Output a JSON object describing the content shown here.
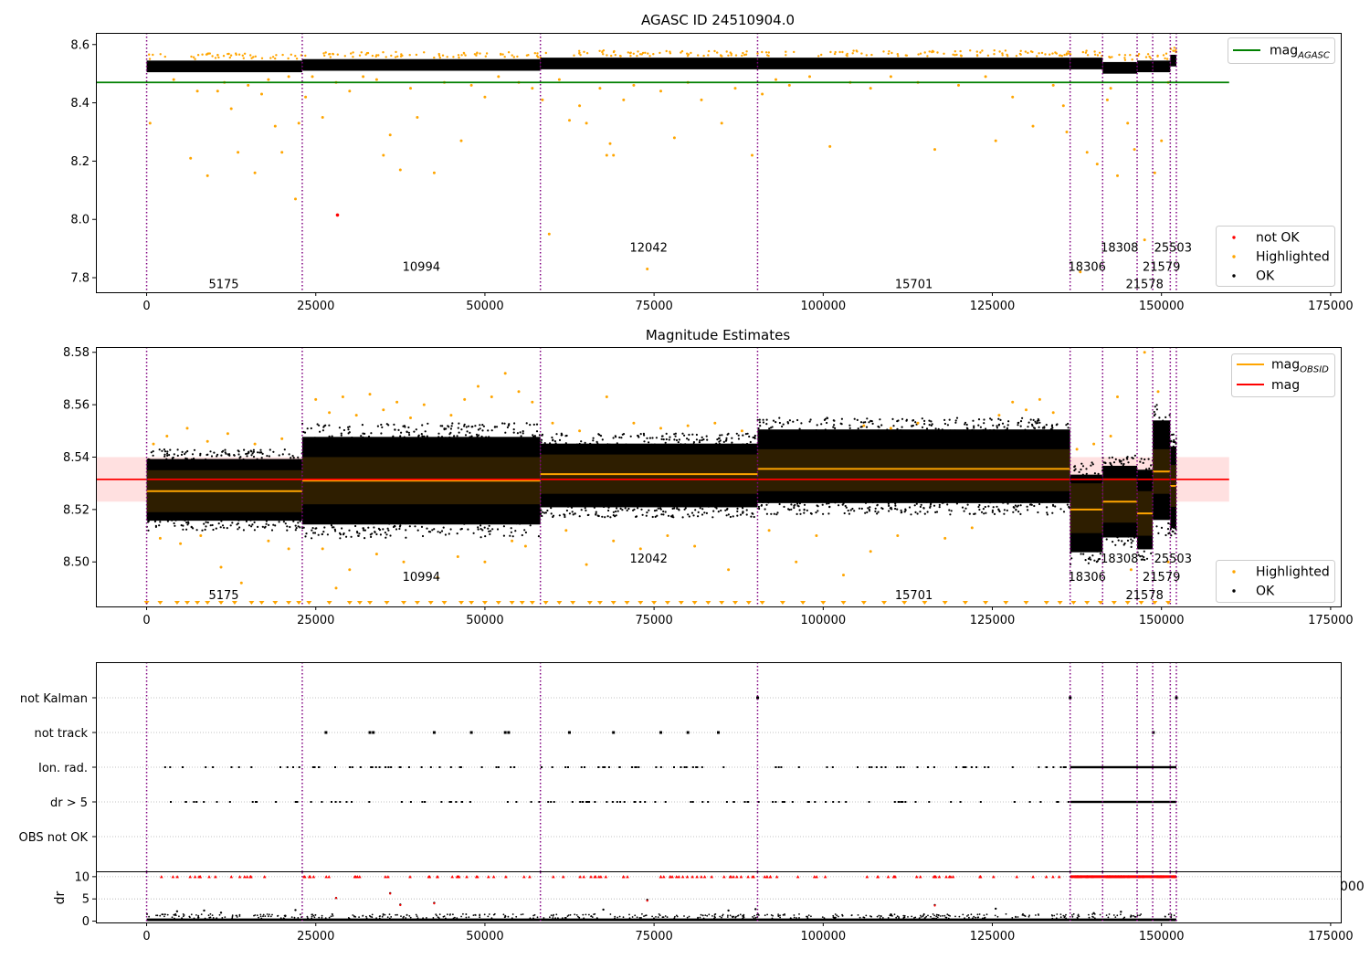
{
  "colors": {
    "ok": "#000000",
    "highlighted": "#ffa500",
    "not_ok": "#ff0000",
    "mag_agasc": "#008000",
    "mag": "#ff0000",
    "mag_obsid": "#ffa500",
    "obs_boundary": "#800080",
    "band_fill": "#ffcccc"
  },
  "chart_data": [
    {
      "type": "scatter",
      "title": "AGASC ID 24510904.0",
      "xlim": [
        -7500,
        176500
      ],
      "ylim": [
        7.75,
        8.64
      ],
      "xticks": [
        0,
        25000,
        50000,
        75000,
        100000,
        125000,
        150000,
        175000
      ],
      "xtick_labels": [
        "0",
        "25000",
        "50000",
        "75000",
        "100000",
        "125000",
        "150000",
        "175000"
      ],
      "yticks": [
        7.8,
        8.0,
        8.2,
        8.4,
        8.6
      ],
      "ytick_labels": [
        "7.8",
        "8.0",
        "8.2",
        "8.4",
        "8.6"
      ],
      "obs_boundaries": [
        0,
        23000,
        58200,
        90300,
        136500,
        141300,
        146400,
        148700,
        151300,
        152200
      ],
      "obsid_labels": [
        {
          "text": "5175",
          "x": 11400,
          "y": 7.78
        },
        {
          "text": "10994",
          "x": 40600,
          "y": 7.84
        },
        {
          "text": "12042",
          "x": 74200,
          "y": 7.905
        },
        {
          "text": "15701",
          "x": 113400,
          "y": 7.78
        },
        {
          "text": "18306",
          "x": 139000,
          "y": 7.84
        },
        {
          "text": "18308",
          "x": 143800,
          "y": 7.905
        },
        {
          "text": "21578",
          "x": 147500,
          "y": 7.78
        },
        {
          "text": "21579",
          "x": 150000,
          "y": 7.84
        },
        {
          "text": "25503",
          "x": 151700,
          "y": 7.905
        }
      ],
      "mag_agasc": 8.47,
      "mag_agasc_xrange": [
        -7500,
        160000
      ],
      "segments_mean": [
        8.525,
        8.53,
        8.535,
        8.535,
        8.535,
        8.52,
        8.525,
        8.525,
        8.545,
        8.53
      ],
      "highlighted_points": [
        [
          500,
          8.33
        ],
        [
          4000,
          8.48
        ],
        [
          6500,
          8.21
        ],
        [
          7500,
          8.44
        ],
        [
          9000,
          8.15
        ],
        [
          10500,
          8.44
        ],
        [
          11500,
          8.47
        ],
        [
          12500,
          8.38
        ],
        [
          13500,
          8.23
        ],
        [
          15000,
          8.46
        ],
        [
          16000,
          8.16
        ],
        [
          17000,
          8.43
        ],
        [
          18000,
          8.48
        ],
        [
          19000,
          8.32
        ],
        [
          20000,
          8.23
        ],
        [
          21000,
          8.49
        ],
        [
          22000,
          8.07
        ],
        [
          22500,
          8.33
        ],
        [
          23500,
          8.42
        ],
        [
          24500,
          8.49
        ],
        [
          26000,
          8.35
        ],
        [
          28000,
          8.47
        ],
        [
          30000,
          8.44
        ],
        [
          32000,
          8.49
        ],
        [
          34000,
          8.48
        ],
        [
          35000,
          8.22
        ],
        [
          36000,
          8.29
        ],
        [
          37500,
          8.17
        ],
        [
          39000,
          8.45
        ],
        [
          40000,
          8.35
        ],
        [
          42500,
          8.16
        ],
        [
          44000,
          8.47
        ],
        [
          46500,
          8.27
        ],
        [
          48000,
          8.46
        ],
        [
          50000,
          8.42
        ],
        [
          52000,
          8.49
        ],
        [
          55000,
          8.47
        ],
        [
          57000,
          8.45
        ],
        [
          58500,
          8.41
        ],
        [
          59500,
          7.95
        ],
        [
          61000,
          8.48
        ],
        [
          62500,
          8.34
        ],
        [
          64000,
          8.39
        ],
        [
          65000,
          8.33
        ],
        [
          67000,
          8.45
        ],
        [
          68000,
          8.22
        ],
        [
          68500,
          8.26
        ],
        [
          69000,
          8.22
        ],
        [
          70500,
          8.41
        ],
        [
          72000,
          8.46
        ],
        [
          74000,
          7.83
        ],
        [
          76000,
          8.44
        ],
        [
          78000,
          8.28
        ],
        [
          80000,
          8.47
        ],
        [
          82000,
          8.41
        ],
        [
          85000,
          8.33
        ],
        [
          87000,
          8.45
        ],
        [
          89500,
          8.22
        ],
        [
          91000,
          8.43
        ],
        [
          93000,
          8.48
        ],
        [
          95000,
          8.46
        ],
        [
          98000,
          8.49
        ],
        [
          101000,
          8.25
        ],
        [
          104000,
          8.47
        ],
        [
          107000,
          8.45
        ],
        [
          110000,
          8.49
        ],
        [
          114000,
          8.47
        ],
        [
          116500,
          8.24
        ],
        [
          120000,
          8.46
        ],
        [
          124000,
          8.49
        ],
        [
          125500,
          8.27
        ],
        [
          128000,
          8.42
        ],
        [
          131000,
          8.32
        ],
        [
          134000,
          8.46
        ],
        [
          135500,
          8.39
        ],
        [
          136000,
          8.3
        ],
        [
          138000,
          7.82
        ],
        [
          139000,
          8.23
        ],
        [
          140500,
          8.19
        ],
        [
          142000,
          8.41
        ],
        [
          142500,
          8.45
        ],
        [
          143500,
          8.15
        ],
        [
          145000,
          8.33
        ],
        [
          146000,
          8.24
        ],
        [
          147500,
          7.93
        ],
        [
          149000,
          8.16
        ],
        [
          150000,
          8.27
        ],
        [
          151000,
          8.47
        ]
      ],
      "not_ok_points": [
        [
          28200,
          8.015
        ]
      ],
      "legend_top": [
        {
          "label": "mag_AGASC"
        }
      ],
      "legend_bottom": [
        {
          "label": "not OK"
        },
        {
          "label": "Highlighted"
        },
        {
          "label": "OK"
        }
      ]
    },
    {
      "type": "scatter",
      "title": "Magnitude Estimates",
      "xlim": [
        -7500,
        176500
      ],
      "ylim": [
        8.483,
        8.582
      ],
      "xticks": [
        0,
        25000,
        50000,
        75000,
        100000,
        125000,
        150000,
        175000
      ],
      "xtick_labels": [
        "0",
        "25000",
        "50000",
        "75000",
        "100000",
        "125000",
        "150000",
        "175000"
      ],
      "yticks": [
        8.5,
        8.52,
        8.54,
        8.56,
        8.58
      ],
      "ytick_labels": [
        "8.50",
        "8.52",
        "8.54",
        "8.56",
        "8.58"
      ],
      "obsid_labels": [
        {
          "text": "5175",
          "x": 11400,
          "y": 8.4875
        },
        {
          "text": "10994",
          "x": 40600,
          "y": 8.4945
        },
        {
          "text": "12042",
          "x": 74200,
          "y": 8.5015
        },
        {
          "text": "15701",
          "x": 113400,
          "y": 8.4875
        },
        {
          "text": "18306",
          "x": 139000,
          "y": 8.4945
        },
        {
          "text": "18308",
          "x": 143800,
          "y": 8.5015
        },
        {
          "text": "21578",
          "x": 147500,
          "y": 8.4875
        },
        {
          "text": "21579",
          "x": 150000,
          "y": 8.4945
        },
        {
          "text": "25503",
          "x": 151700,
          "y": 8.5015
        }
      ],
      "mag": 8.5315,
      "mag_band": [
        8.523,
        8.54
      ],
      "mag_xrange": [
        -7500,
        160000
      ],
      "mag_obsid": [
        {
          "x0": 0,
          "x1": 23000,
          "y": 8.527,
          "lo": 8.519,
          "hi": 8.535
        },
        {
          "x0": 23000,
          "x1": 58200,
          "y": 8.531,
          "lo": 8.522,
          "hi": 8.54
        },
        {
          "x0": 58200,
          "x1": 90300,
          "y": 8.5335,
          "lo": 8.526,
          "hi": 8.541
        },
        {
          "x0": 90300,
          "x1": 136500,
          "y": 8.5355,
          "lo": 8.527,
          "hi": 8.543
        },
        {
          "x0": 136500,
          "x1": 141300,
          "y": 8.52,
          "lo": 8.511,
          "hi": 8.53
        },
        {
          "x0": 141300,
          "x1": 146400,
          "y": 8.523,
          "lo": 8.515,
          "hi": 8.532
        },
        {
          "x0": 146400,
          "x1": 148700,
          "y": 8.5185,
          "lo": 8.51,
          "hi": 8.527
        },
        {
          "x0": 148700,
          "x1": 151300,
          "y": 8.5345,
          "lo": 8.526,
          "hi": 8.543
        },
        {
          "x0": 151300,
          "x1": 152200,
          "y": 8.529,
          "lo": 8.521,
          "hi": 8.537
        }
      ],
      "ok_ranges": [
        {
          "x0": 0,
          "x1": 23000,
          "lo": 8.512,
          "hi": 8.543
        },
        {
          "x0": 23000,
          "x1": 58200,
          "lo": 8.509,
          "hi": 8.553
        },
        {
          "x0": 58200,
          "x1": 90300,
          "lo": 8.517,
          "hi": 8.549
        },
        {
          "x0": 90300,
          "x1": 136500,
          "lo": 8.518,
          "hi": 8.555
        },
        {
          "x0": 136500,
          "x1": 141300,
          "lo": 8.499,
          "hi": 8.538
        },
        {
          "x0": 141300,
          "x1": 146400,
          "lo": 8.505,
          "hi": 8.541
        },
        {
          "x0": 146400,
          "x1": 148700,
          "lo": 8.5,
          "hi": 8.54
        },
        {
          "x0": 148700,
          "x1": 151300,
          "lo": 8.51,
          "hi": 8.56
        },
        {
          "x0": 151300,
          "x1": 152200,
          "lo": 8.508,
          "hi": 8.549
        }
      ],
      "highlighted_points": [
        [
          1000,
          8.545
        ],
        [
          3000,
          8.548
        ],
        [
          6000,
          8.551
        ],
        [
          9000,
          8.546
        ],
        [
          12000,
          8.549
        ],
        [
          16000,
          8.545
        ],
        [
          20000,
          8.547
        ],
        [
          2000,
          8.509
        ],
        [
          5000,
          8.507
        ],
        [
          8000,
          8.51
        ],
        [
          11000,
          8.498
        ],
        [
          14000,
          8.492
        ],
        [
          18000,
          8.508
        ],
        [
          21000,
          8.505
        ],
        [
          25000,
          8.562
        ],
        [
          27000,
          8.557
        ],
        [
          29000,
          8.563
        ],
        [
          31000,
          8.556
        ],
        [
          33000,
          8.564
        ],
        [
          35000,
          8.558
        ],
        [
          37000,
          8.561
        ],
        [
          39000,
          8.555
        ],
        [
          41000,
          8.56
        ],
        [
          45000,
          8.556
        ],
        [
          47000,
          8.562
        ],
        [
          49000,
          8.567
        ],
        [
          51000,
          8.563
        ],
        [
          53000,
          8.572
        ],
        [
          55000,
          8.565
        ],
        [
          57000,
          8.561
        ],
        [
          26000,
          8.505
        ],
        [
          28000,
          8.49
        ],
        [
          30000,
          8.497
        ],
        [
          34000,
          8.503
        ],
        [
          38000,
          8.5
        ],
        [
          43000,
          8.494
        ],
        [
          46000,
          8.502
        ],
        [
          50000,
          8.5
        ],
        [
          54000,
          8.508
        ],
        [
          56000,
          8.506
        ],
        [
          60000,
          8.553
        ],
        [
          64000,
          8.55
        ],
        [
          68000,
          8.563
        ],
        [
          72000,
          8.553
        ],
        [
          76000,
          8.551
        ],
        [
          80000,
          8.552
        ],
        [
          84000,
          8.553
        ],
        [
          88000,
          8.55
        ],
        [
          62000,
          8.512
        ],
        [
          65000,
          8.499
        ],
        [
          69000,
          8.508
        ],
        [
          73000,
          8.505
        ],
        [
          77000,
          8.51
        ],
        [
          81000,
          8.506
        ],
        [
          86000,
          8.497
        ],
        [
          92000,
          8.512
        ],
        [
          96000,
          8.5
        ],
        [
          99000,
          8.51
        ],
        [
          103000,
          8.495
        ],
        [
          107000,
          8.504
        ],
        [
          111000,
          8.51
        ],
        [
          118000,
          8.509
        ],
        [
          122000,
          8.513
        ],
        [
          126000,
          8.556
        ],
        [
          128000,
          8.561
        ],
        [
          130000,
          8.558
        ],
        [
          132000,
          8.562
        ],
        [
          134000,
          8.557
        ],
        [
          114000,
          8.553
        ],
        [
          110000,
          8.551
        ],
        [
          106000,
          8.552
        ],
        [
          137500,
          8.543
        ],
        [
          140000,
          8.545
        ],
        [
          142500,
          8.548
        ],
        [
          143500,
          8.563
        ],
        [
          145500,
          8.497
        ],
        [
          147500,
          8.58
        ],
        [
          149500,
          8.565
        ],
        [
          151000,
          8.5
        ]
      ],
      "floor_marker_xs": [
        0,
        2000,
        4500,
        6000,
        7500,
        9000,
        11000,
        13000,
        15500,
        17000,
        19000,
        21000,
        22500,
        24000,
        27000,
        30000,
        31500,
        33000,
        35500,
        38000,
        40000,
        42000,
        44000,
        46500,
        48000,
        50000,
        52000,
        54000,
        55500,
        57000,
        59000,
        61000,
        63000,
        65500,
        67000,
        69000,
        71000,
        73000,
        75000,
        77000,
        79000,
        81000,
        83000,
        85000,
        87000,
        89000,
        91000,
        94000,
        97000,
        100000,
        103000,
        106000,
        109000,
        112000,
        115000,
        118000,
        121000,
        124000,
        127000,
        130000,
        133000,
        135000,
        137000,
        139000,
        141000,
        143000,
        145000,
        147000,
        149000,
        151000
      ],
      "legend_top": [
        {
          "label": "mag_OBSID"
        },
        {
          "label": "mag"
        }
      ],
      "legend_bottom": [
        {
          "label": "Highlighted"
        },
        {
          "label": "OK"
        }
      ]
    },
    {
      "type": "scatter",
      "xlim": [
        -7500,
        176500
      ],
      "flag_rows": [
        "not Kalman",
        "not track",
        "Ion. rad.",
        "dr > 5",
        "OBS not OK"
      ],
      "flag_ranges": [
        {
          "row": "Ion. rad.",
          "ranges": [
            [
              0,
              136500,
              0.35
            ],
            [
              136500,
              152200,
              1.0
            ]
          ]
        },
        {
          "row": "dr > 5",
          "ranges": [
            [
              0,
              136500,
              0.35
            ],
            [
              136500,
              152200,
              1.0
            ]
          ]
        }
      ],
      "flag_points": [
        {
          "row": "not track",
          "x": [
            26500,
            33000,
            33500,
            42500,
            48000,
            53000,
            53500,
            62500,
            69000,
            76000,
            80000,
            84500,
            148800
          ]
        },
        {
          "row": "not Kalman",
          "x": [
            90300,
            136500,
            152200
          ]
        }
      ]
    },
    {
      "type": "scatter",
      "xlim": [
        -7500,
        176500
      ],
      "ylim": [
        -0.3,
        11
      ],
      "ylabel": "dr",
      "xticks": [
        0,
        25000,
        50000,
        75000,
        100000,
        125000,
        150000,
        175000
      ],
      "xtick_labels": [
        "0",
        "25000",
        "50000",
        "75000",
        "100000",
        "125000",
        "150000",
        "175000"
      ],
      "yticks": [
        0,
        5,
        10
      ],
      "ytick_labels": [
        "0",
        "5",
        "10"
      ],
      "dr_outliers": [
        [
          4500,
          2.2
        ],
        [
          8500,
          2.4
        ],
        [
          11000,
          1.9
        ],
        [
          20500,
          1.2
        ],
        [
          22000,
          2.5
        ],
        [
          28000,
          5.2
        ],
        [
          36000,
          6.3
        ],
        [
          37500,
          3.7
        ],
        [
          42500,
          4.1
        ],
        [
          67500,
          2.6
        ],
        [
          74000,
          4.8
        ],
        [
          86000,
          2.4
        ],
        [
          90000,
          2.7
        ],
        [
          110000,
          1.5
        ],
        [
          116500,
          3.6
        ],
        [
          125500,
          2.8
        ],
        [
          140000,
          1.8
        ],
        [
          144000,
          2.1
        ]
      ],
      "clip_marker_value": 10,
      "clipped_label": "000"
    }
  ]
}
